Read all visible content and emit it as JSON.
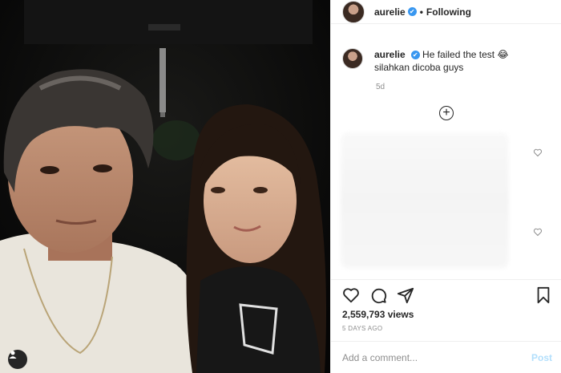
{
  "post": {
    "username": "aurelie",
    "verified_mark": "✔",
    "separator": "•",
    "follow_status": "Following",
    "caption_text": "He failed the test",
    "caption_emoji": "😂",
    "caption_line2": "silahkan dicoba guys",
    "caption_age": "5d",
    "views": "2,559,793 views",
    "posted": "5 DAYS AGO"
  },
  "comment": {
    "placeholder": "Add a comment...",
    "post_label": "Post"
  },
  "icons": {
    "load_more": "+",
    "like": "heart-icon",
    "comment": "comment-icon",
    "share": "share-icon",
    "save": "bookmark-icon",
    "tag": "user-tag-icon"
  },
  "colors": {
    "verified": "#3897f0",
    "muted": "#8e8e8e",
    "post_disabled": "#b2dffc"
  }
}
